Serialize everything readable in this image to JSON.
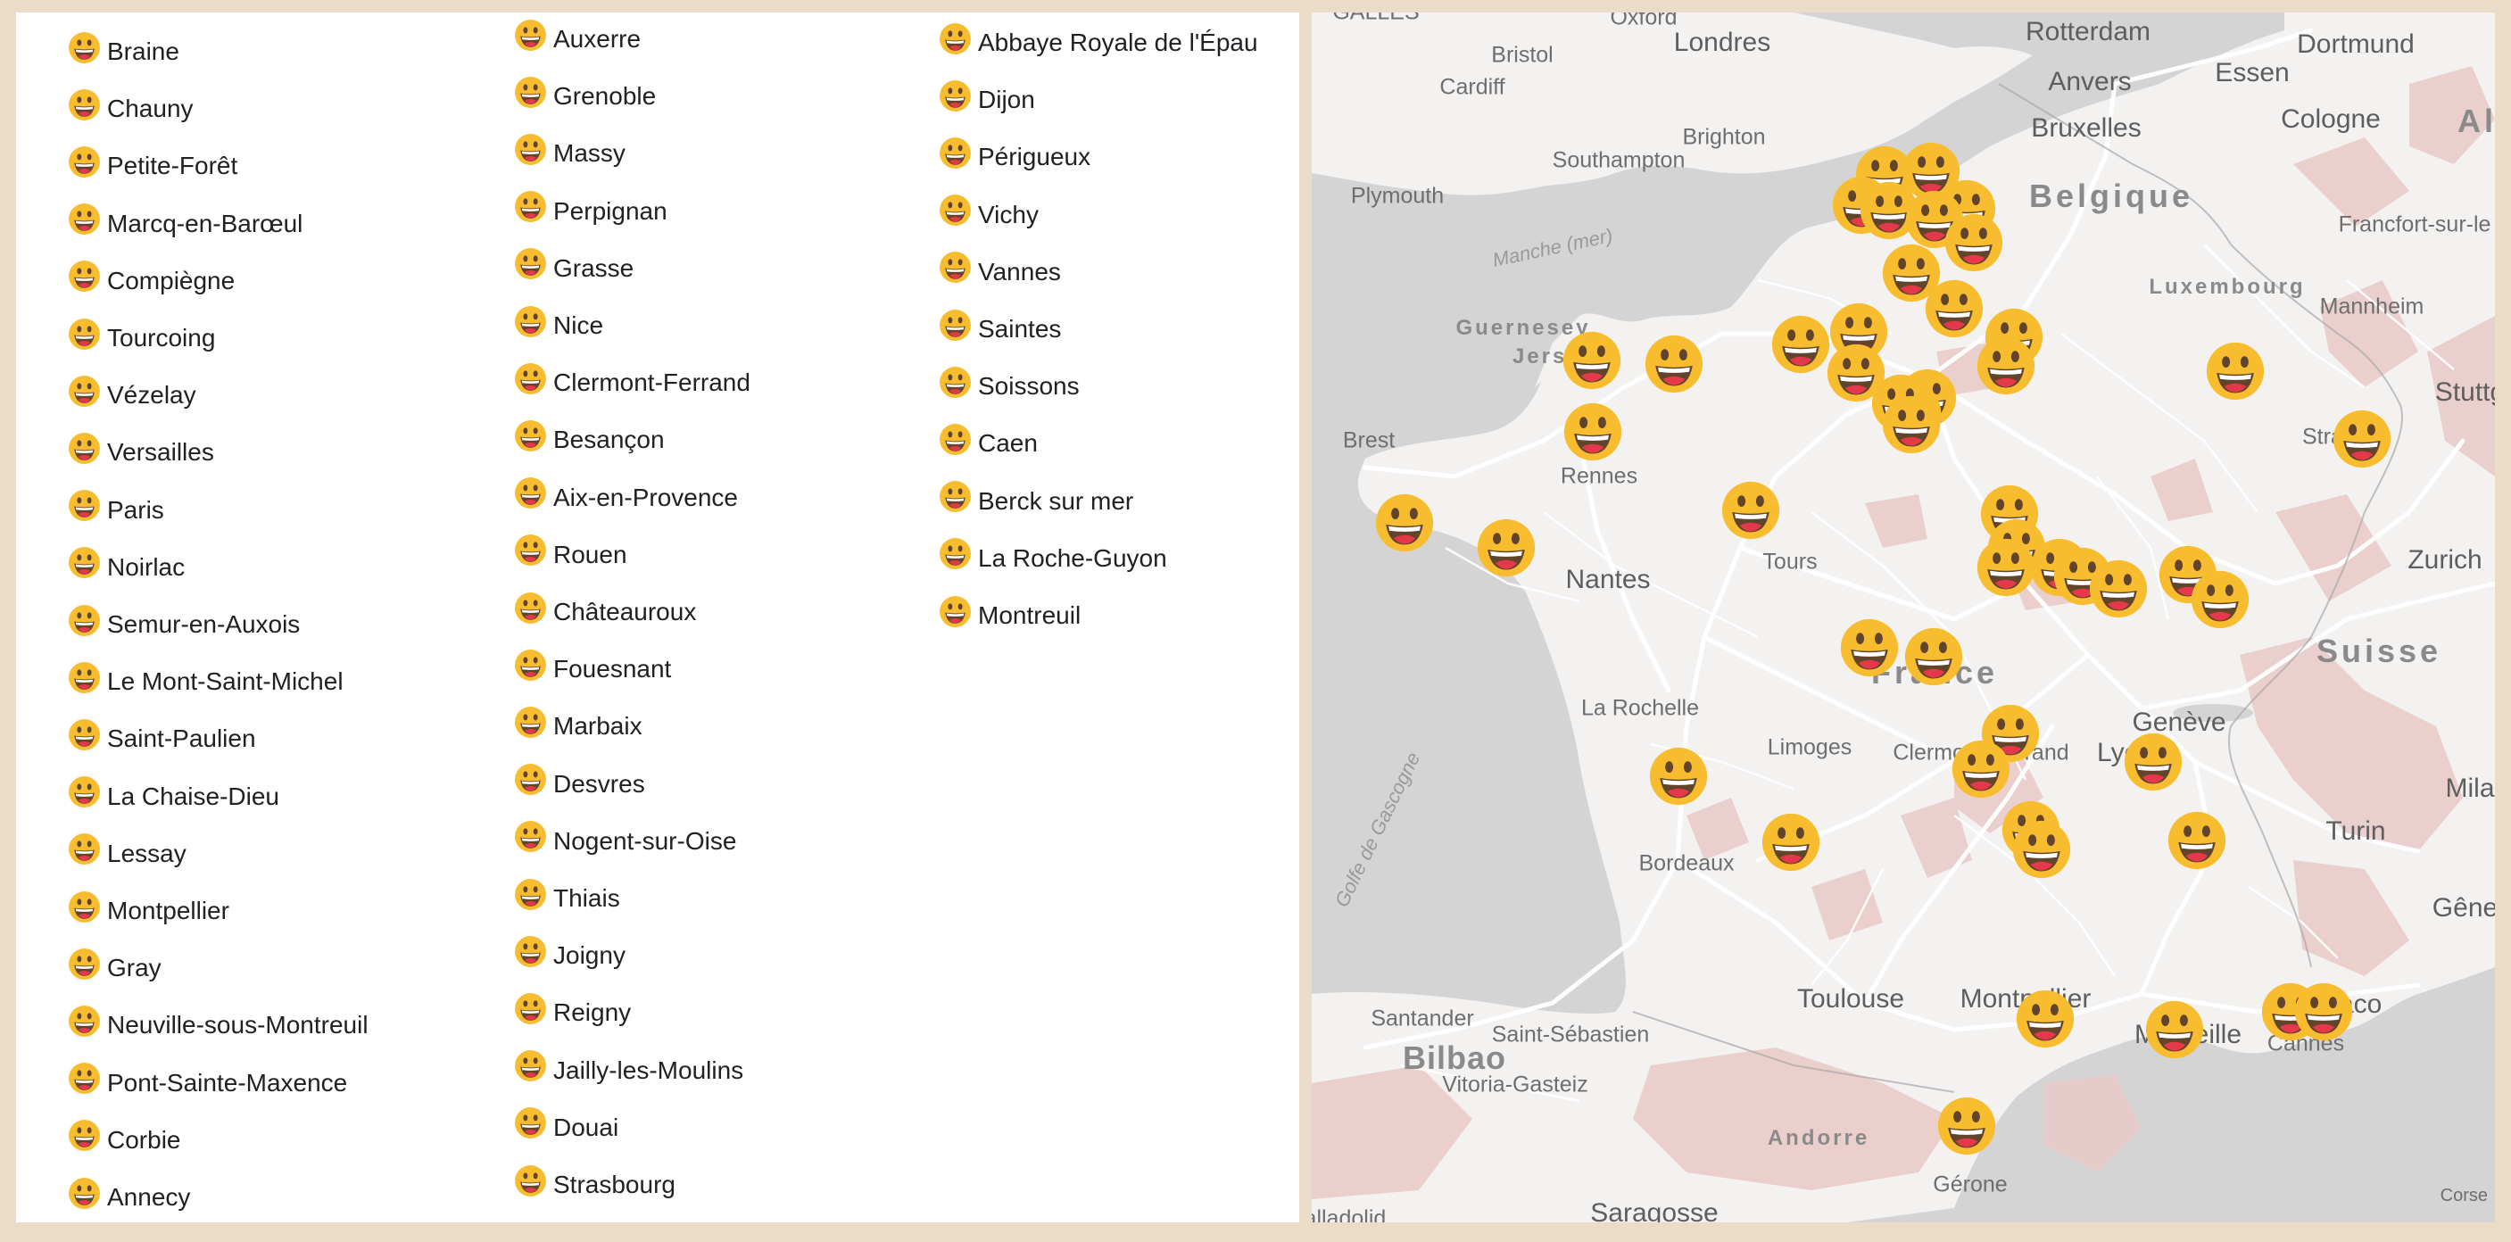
{
  "list": {
    "icon": "grinning-face-icon",
    "col1": [
      "Braine",
      "Chauny",
      "Petite-Forêt",
      "Marcq-en-Barœul",
      "Compiègne",
      "Tourcoing",
      "Vézelay",
      "Versailles",
      "Paris",
      "Noirlac",
      "Semur-en-Auxois",
      "Le Mont-Saint-Michel",
      "Saint-Paulien",
      "La Chaise-Dieu",
      "Lessay",
      "Montpellier",
      "Gray",
      "Neuville-sous-Montreuil",
      "Pont-Sainte-Maxence",
      "Corbie",
      "Annecy"
    ],
    "col2": [
      "Auxerre",
      "Grenoble",
      "Massy",
      "Perpignan",
      "Grasse",
      "Nice",
      "Clermont-Ferrand",
      "Besançon",
      "Aix-en-Provence",
      "Rouen",
      "Châteauroux",
      "Fouesnant",
      "Marbaix",
      "Desvres",
      "Nogent-sur-Oise",
      "Thiais",
      "Joigny",
      "Reigny",
      "Jailly-les-Moulins",
      "Douai",
      "Strasbourg"
    ],
    "col3": [
      "Abbaye Royale de l'Épau",
      "Dijon",
      "Périgueux",
      "Vichy",
      "Vannes",
      "Saintes",
      "Soissons",
      "Caen",
      "Berck sur mer",
      "La Roche-Guyon",
      "Montreuil"
    ]
  },
  "map": {
    "places": {
      "galles": "GALLES",
      "oxford": "Oxford",
      "londres": "Londres",
      "bristol": "Bristol",
      "cardiff": "Cardiff",
      "rotterdam": "Rotterdam",
      "dortmund": "Dortmund",
      "anvers": "Anvers",
      "essen": "Essen",
      "bruxelles": "Bruxelles",
      "cologne": "Cologne",
      "al": "Al",
      "brighton": "Brighton",
      "southampton": "Southampton",
      "plymouth": "Plymouth",
      "belgique": "Belgique",
      "francfort": "Francfort-sur-le",
      "manche": "Manche (mer)",
      "luxembourg": "Luxembourg",
      "mannheim": "Mannheim",
      "guernesey": "Guernesey",
      "jersey": "Jersey",
      "stuttg": "Stuttg",
      "brest": "Brest",
      "rennes": "Rennes",
      "strasbourg": "Strasbou",
      "nantes": "Nantes",
      "tours": "Tours",
      "zurich": "Zurich",
      "suisse": "Suisse",
      "france": "France",
      "larochelle": "La Rochelle",
      "limoges": "Limoges",
      "clermont": "Clermont-Ferrand",
      "lyon": "Lyon",
      "geneve": "Genève",
      "mila": "Mila",
      "golfe": "Golfe de Gascogne",
      "bordeaux": "Bordeaux",
      "turin": "Turin",
      "genes": "Gênes",
      "toulouse": "Toulouse",
      "montpellier": "Montpellier",
      "santander": "Santander",
      "saintsebastien": "Saint-Sébastien",
      "marseille": "Marseille",
      "monaco": "Monaco",
      "bilbao": "Bilbao",
      "vitoria": "Vitoria-Gasteiz",
      "cannes": "Cannes",
      "andorre": "Andorre",
      "gerone": "Gérone",
      "valladolid": "Valladolid",
      "saragosse": "Saragosse",
      "corse": "Corse"
    },
    "marker_icon": "grinning-face-icon",
    "colors": {
      "water": "#d4d4d4",
      "land": "#f4f2f0",
      "terrain": "#e8c9c7",
      "roads": "#ffffff",
      "marker": "#f8bd2f"
    }
  }
}
